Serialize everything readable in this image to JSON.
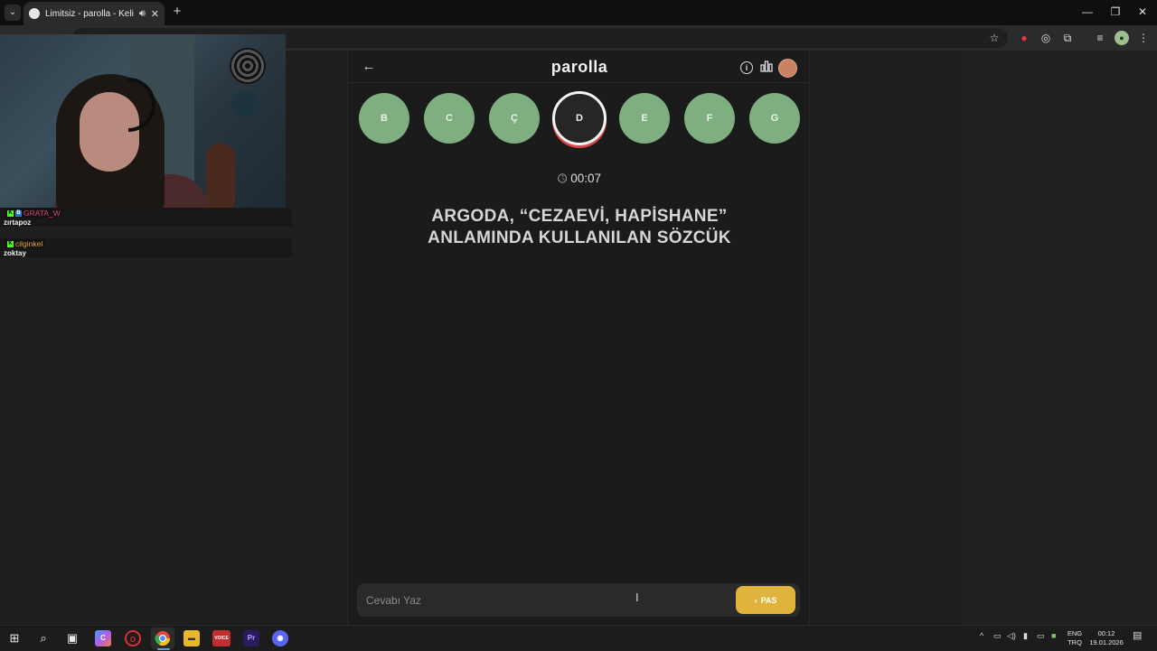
{
  "browser": {
    "tab_title": "Limitsiz - parolla - Kelime o",
    "tab_audio_icon": "speaker-icon",
    "new_tab": "+",
    "window_controls": {
      "minimize": "—",
      "restore": "❐",
      "close": "✕"
    }
  },
  "app": {
    "logo": "parolla",
    "letters": [
      {
        "letter": "B",
        "state": "done"
      },
      {
        "letter": "C",
        "state": "done"
      },
      {
        "letter": "Ç",
        "state": "done"
      },
      {
        "letter": "D",
        "state": "active"
      },
      {
        "letter": "E",
        "state": "pending"
      },
      {
        "letter": "F",
        "state": "pending"
      },
      {
        "letter": "G",
        "state": "pending"
      }
    ],
    "timer": "00:07",
    "question_line1": "ARGODA, “CEZAEVİ, HAPİSHANE”",
    "question_line2": "ANLAMINDA KULLANILAN SÖZCÜK",
    "answer_placeholder": "Cevabı Yaz",
    "pass_button": "PAS",
    "colors": {
      "letter_bg": "#7fae80",
      "active_ring": "#e04545",
      "pass_bg": "#e0b43a"
    }
  },
  "chat": [
    {
      "user": "GRATA_W",
      "user_color": "#e0407a",
      "badges": [
        "K",
        "B"
      ],
      "text": "zırtapoz"
    },
    {
      "user": "cilginkel",
      "user_color": "#e7a23b",
      "badges": [
        "K"
      ],
      "text": "zoktay"
    }
  ],
  "taskbar": {
    "language_top": "ENG",
    "language_bottom": "TRQ",
    "time": "00:12",
    "date": "19.01.2026",
    "apps": [
      "windows-start-icon",
      "search-icon",
      "task-view-icon",
      "copilot-icon",
      "opera-gx-icon",
      "chrome-icon",
      "file-explorer-icon",
      "voice-app-icon",
      "premiere-pro-icon",
      "discord-icon"
    ]
  }
}
